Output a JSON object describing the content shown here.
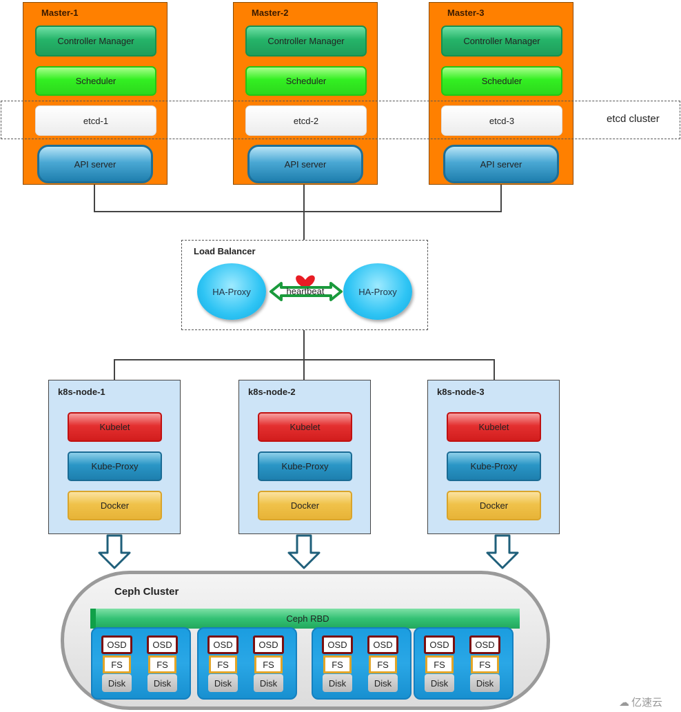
{
  "masters": [
    {
      "title": "Master-1",
      "controller": "Controller Manager",
      "scheduler": "Scheduler",
      "etcd": "etcd-1",
      "api": "API server"
    },
    {
      "title": "Master-2",
      "controller": "Controller Manager",
      "scheduler": "Scheduler",
      "etcd": "etcd-2",
      "api": "API server"
    },
    {
      "title": "Master-3",
      "controller": "Controller Manager",
      "scheduler": "Scheduler",
      "etcd": "etcd-3",
      "api": "API server"
    }
  ],
  "etcd_cluster_label": "etcd cluster",
  "load_balancer": {
    "title": "Load Balancer",
    "left": "HA-Proxy",
    "right": "HA-Proxy",
    "link": "heartbeat"
  },
  "nodes": [
    {
      "title": "k8s-node-1",
      "kubelet": "Kubelet",
      "proxy": "Kube-Proxy",
      "docker": "Docker"
    },
    {
      "title": "k8s-node-2",
      "kubelet": "Kubelet",
      "proxy": "Kube-Proxy",
      "docker": "Docker"
    },
    {
      "title": "k8s-node-3",
      "kubelet": "Kubelet",
      "proxy": "Kube-Proxy",
      "docker": "Docker"
    }
  ],
  "ceph": {
    "title": "Ceph Cluster",
    "rbd": "Ceph RBD",
    "osd": "OSD",
    "fs": "FS",
    "disk": "Disk",
    "groups": 4,
    "osds_per_group": 2
  },
  "watermark": "亿速云",
  "colors": {
    "master": "#ff8000",
    "node": "#cde4f7",
    "heartbeat": "#1a9a3c"
  }
}
